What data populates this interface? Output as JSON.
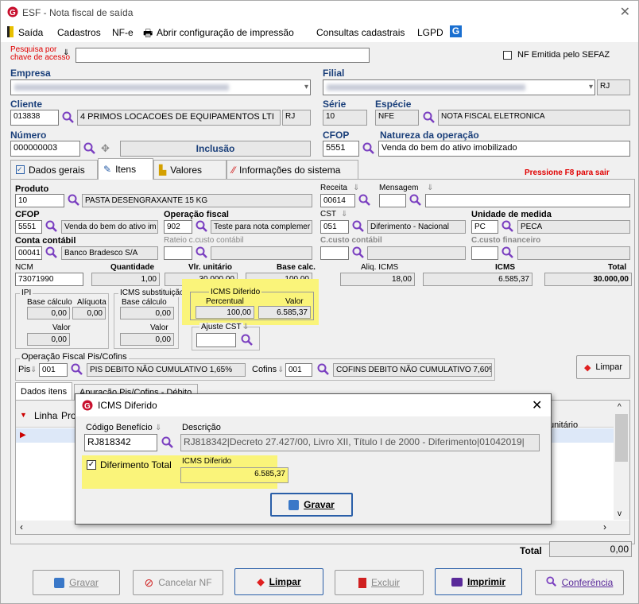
{
  "window": {
    "title": "ESF - Nota fiscal de saída",
    "close": "✕"
  },
  "menu": {
    "saida": "Saída",
    "cadastros": "Cadastros",
    "nfe": "NF-e",
    "print_config": "Abrir configuração de impressão",
    "consultas": "Consultas cadastrais",
    "lgpd": "LGPD"
  },
  "search": {
    "label1": "Pesquisa por",
    "label2": "chave de acesso",
    "value": "",
    "sefaz": "NF Emitida pelo SEFAZ"
  },
  "header": {
    "empresa_label": "Empresa",
    "filial_label": "Filial",
    "filial_uf": "RJ",
    "cliente_label": "Cliente",
    "cliente_code": "013838",
    "cliente_name": "4 PRIMOS LOCACOES DE EQUIPAMENTOS LTI",
    "cliente_uf": "RJ",
    "serie_label": "Série",
    "serie": "10",
    "especie_label": "Espécie",
    "especie_code": "NFE",
    "especie_desc": "NOTA FISCAL ELETRONICA",
    "numero_label": "Número",
    "numero": "000000003",
    "status": "Inclusão",
    "cfop_label": "CFOP",
    "cfop": "5551",
    "natureza_label": "Natureza da operação",
    "natureza": "Venda do bem do ativo imobilizado"
  },
  "tabs": [
    {
      "label": "Dados gerais"
    },
    {
      "label": "Itens"
    },
    {
      "label": "Valores"
    },
    {
      "label": "Informações do sistema"
    }
  ],
  "f8": "Pressione F8 para sair",
  "item": {
    "produto_label": "Produto",
    "produto_code": "10",
    "produto_desc": "PASTA DESENGRAXANTE 15 KG",
    "receita_label": "Receita",
    "receita": "00614",
    "mensagem_label": "Mensagem",
    "cfop_label": "CFOP",
    "cfop": "5551",
    "cfop_desc": "Venda do bem do ativo im",
    "opfiscal_label": "Operação fiscal",
    "opfiscal": "902",
    "opfiscal_desc": "Teste para nota complemer",
    "cst_label": "CST",
    "cst": "051",
    "cst_desc": "Diferimento - Nacional",
    "um_label": "Unidade de medida",
    "um": "PC",
    "um_desc": "PECA",
    "conta_label": "Conta contábil",
    "conta": "00041",
    "conta_desc": "Banco Bradesco S/A",
    "rateio_label": "Rateio c.custo contábil",
    "ccusto_label": "C.custo contábil",
    "ccfin_label": "C.custo financeiro",
    "ncm_label": "NCM",
    "ncm": "73071990",
    "qtd_label": "Quantidade",
    "qtd": "1,00",
    "vlr_label": "Vlr. unitário",
    "vlr": "30.000,00",
    "base_label": "Base calc.",
    "base": "100,00",
    "aliq_label": "Aliq. ICMS",
    "aliq": "18,00",
    "icms_label": "ICMS",
    "icms": "6.585,37",
    "total_label": "Total",
    "total": "30.000,00"
  },
  "ipi": {
    "title": "IPI",
    "base_label": "Base cálculo",
    "aliq_label": "Alíquota",
    "base": "0,00",
    "aliq": "0,00",
    "valor_label": "Valor",
    "valor": "0,00"
  },
  "icmsst": {
    "title": "ICMS substituição",
    "base_label": "Base cálculo",
    "base": "0,00",
    "valor_label": "Valor",
    "valor": "0,00"
  },
  "diferido": {
    "title": "ICMS Diferido",
    "perc_label": "Percentual",
    "valor_label": "Valor",
    "perc": "100,00",
    "valor": "6.585,37"
  },
  "ajuste": {
    "title": "Ajuste CST"
  },
  "piscofins": {
    "title": "Operação Fiscal Pis/Cofins",
    "pis_label": "Pis",
    "pis_code": "001",
    "pis_desc": "PIS DEBITO NÃO CUMULATIVO 1,65%",
    "cofins_label": "Cofins",
    "cofins_code": "001",
    "cofins_desc": "COFINS DEBITO NÃO CUMULATIVO 7,60%",
    "limpar": "Limpar"
  },
  "subtabs": {
    "dados": "Dados itens",
    "apuracao": "Apuração Pis/Cofins - Débito"
  },
  "grid": {
    "col_linha": "Linha",
    "col_pro": "Pro",
    "col_unit": "unitário"
  },
  "total_footer": {
    "label": "Total",
    "value": "0,00"
  },
  "dialog": {
    "title": "ICMS Diferido",
    "codigo_label": "Código Benefício",
    "codigo": "RJ818342",
    "desc_label": "Descrição",
    "desc": "RJ818342|Decreto 27.427/00, Livro XII, Título I de 2000 - Diferimento|01042019|",
    "diferimento_total": "Diferimento Total",
    "icms_diferido_label": "ICMS Diferido",
    "icms_diferido": "6.585,37",
    "gravar": "Gravar"
  },
  "buttons": {
    "gravar": "Gravar",
    "cancelar": "Cancelar NF",
    "limpar": "Limpar",
    "excluir": "Excluir",
    "imprimir": "Imprimir",
    "conferencia": "Conferência"
  }
}
